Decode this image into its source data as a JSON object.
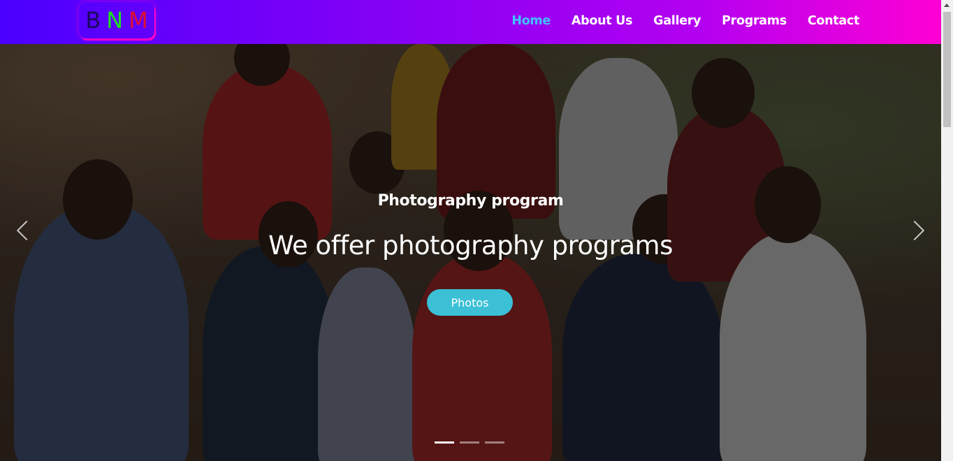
{
  "logo": {
    "letters": [
      "B",
      "N",
      "M"
    ],
    "colors": [
      "#1a0a5e",
      "#1be51b",
      "#e01030"
    ]
  },
  "nav": {
    "items": [
      {
        "label": "Home",
        "active": true
      },
      {
        "label": "About Us",
        "active": false
      },
      {
        "label": "Gallery",
        "active": false
      },
      {
        "label": "Programs",
        "active": false
      },
      {
        "label": "Contact",
        "active": false
      }
    ],
    "gradient": [
      "#4b00ff",
      "#ff00d4"
    ],
    "active_color": "#3fc4ff"
  },
  "hero": {
    "subtitle": "Photography program",
    "title": "We offer photography programs",
    "button_label": "Photos",
    "button_color": "#3bc0d6",
    "prev_icon": "chevron-left-icon",
    "next_icon": "chevron-right-icon",
    "slides_total": 3,
    "active_slide": 1
  }
}
